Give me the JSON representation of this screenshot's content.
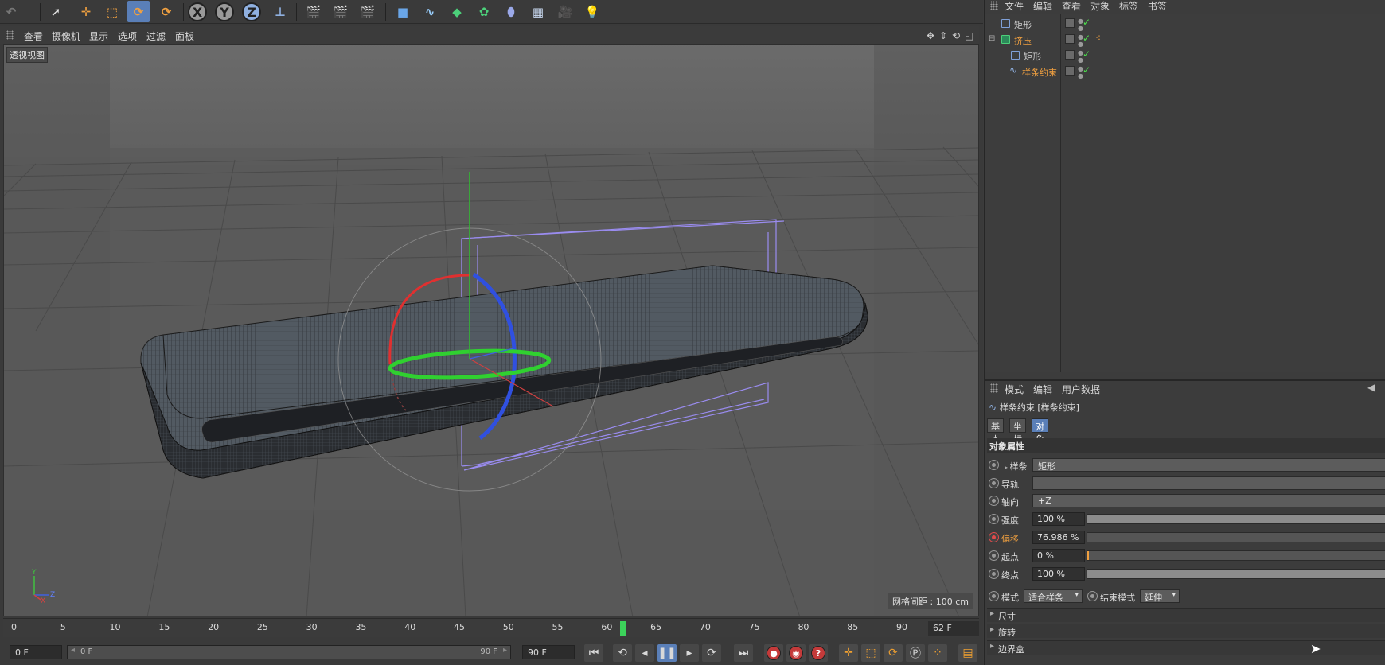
{
  "toolbar": {
    "axes": [
      "X",
      "Y",
      "Z"
    ]
  },
  "viewport_menu": {
    "items": [
      "查看",
      "摄像机",
      "显示",
      "选项",
      "过滤",
      "面板"
    ]
  },
  "viewport": {
    "label": "透视视图",
    "grid_distance": "网格间距 : 100 cm",
    "mini_axes": {
      "y": "Y",
      "z": "Z",
      "x": "X"
    }
  },
  "timeline": {
    "ticks": [
      "0",
      "5",
      "10",
      "15",
      "20",
      "25",
      "30",
      "35",
      "40",
      "45",
      "50",
      "55",
      "60",
      "65",
      "70",
      "75",
      "80",
      "85",
      "90"
    ],
    "current_frame": "62 F",
    "current_frame_value": 62,
    "max_frame_value": 90
  },
  "transport": {
    "start_field": "0 F",
    "range_start": "0 F",
    "range_end": "90 F",
    "end_field": "90 F"
  },
  "object_manager": {
    "menu": [
      "文件",
      "编辑",
      "查看",
      "对象",
      "标签",
      "书签"
    ],
    "objects": [
      {
        "name": "矩形",
        "color": "#cfcfcf"
      },
      {
        "name": "挤压",
        "color": "#f0a040"
      },
      {
        "name": "矩形",
        "color": "#cfcfcf"
      },
      {
        "name": "样条约束",
        "color": "#f0a040"
      }
    ]
  },
  "attributes": {
    "menu": [
      "模式",
      "编辑",
      "用户数据"
    ],
    "title": "样条约束 [样条约束]",
    "tabs": [
      "基本",
      "坐标",
      "对象"
    ],
    "section": "对象属性",
    "props": {
      "spline": {
        "label": "样条",
        "value": "矩形"
      },
      "rail": {
        "label": "导轨",
        "value": ""
      },
      "axis": {
        "label": "轴向",
        "value": "+Z"
      },
      "strength": {
        "label": "强度",
        "value": "100 %",
        "level": 1.0
      },
      "offset": {
        "label": "偏移",
        "value": "76.986 %",
        "level": 0.0
      },
      "start": {
        "label": "起点",
        "value": "0 %",
        "level": 0.0
      },
      "end": {
        "label": "终点",
        "value": "100 %",
        "level": 1.0
      }
    },
    "mode_label": "模式",
    "mode_value": "适合样条",
    "end_mode_label": "结束模式",
    "end_mode_value": "延伸",
    "groups": [
      "尺寸",
      "旋转",
      "边界盒"
    ]
  },
  "colors": {
    "accent": "#5a7fb8",
    "animated": "#f0a040",
    "x_axis": "#e03030",
    "y_axis": "#30d030",
    "z_axis": "#3050e0"
  }
}
